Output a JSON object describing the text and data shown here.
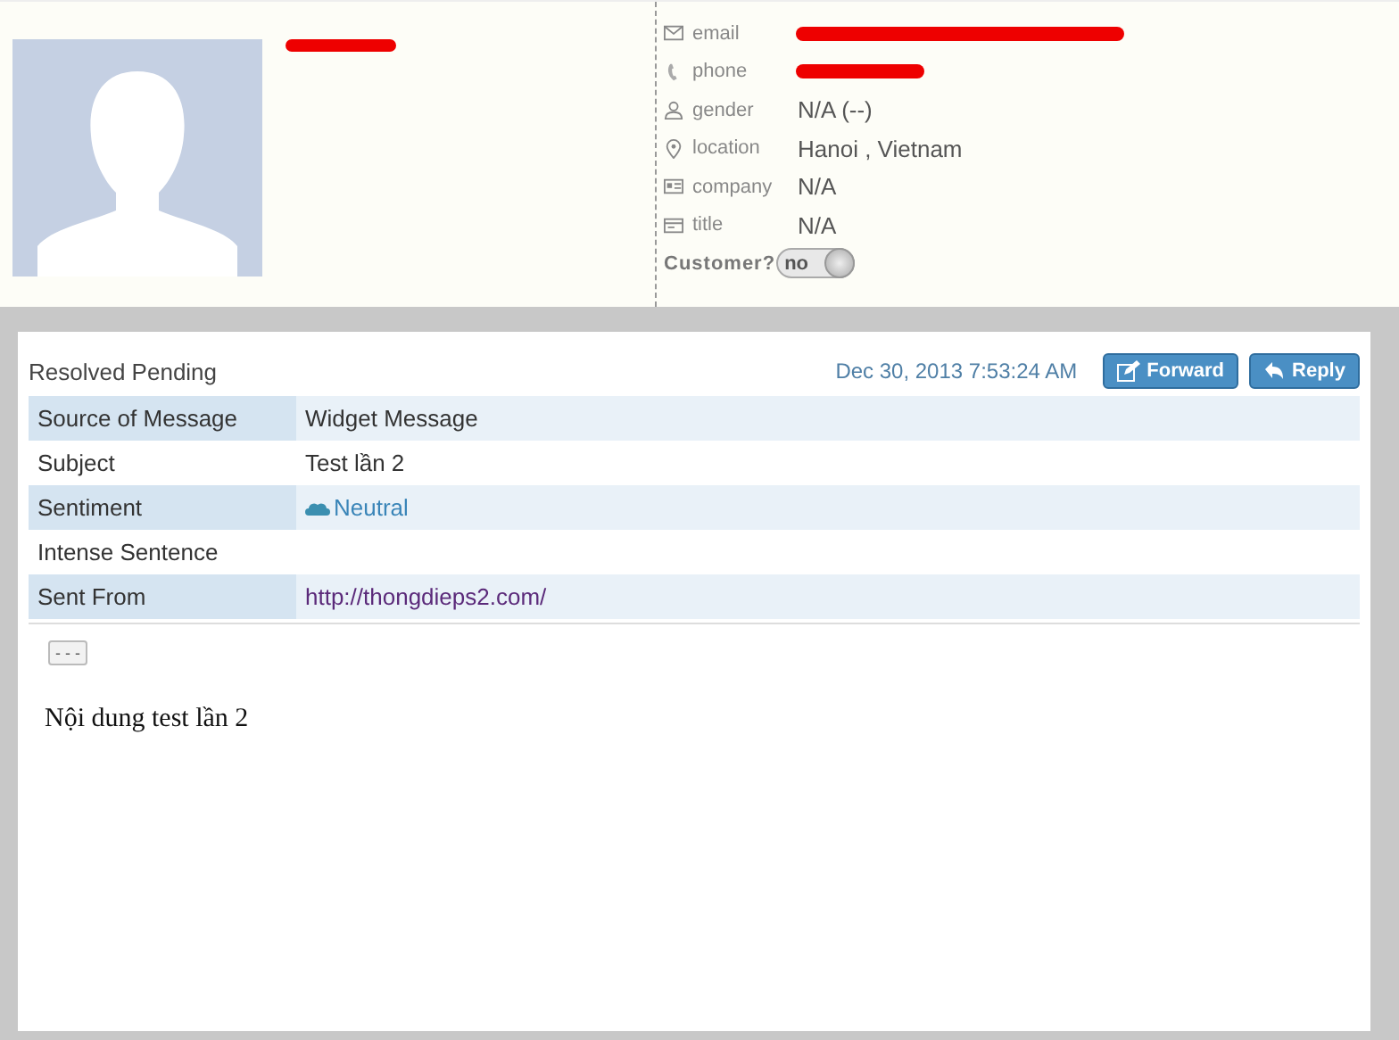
{
  "contact": {
    "fields": [
      {
        "kind": "mail",
        "label": "email",
        "redacted": true
      },
      {
        "kind": "phone",
        "label": "phone",
        "redacted": true
      },
      {
        "kind": "person",
        "label": "gender",
        "value": "N/A (--)"
      },
      {
        "kind": "pin",
        "label": "location",
        "value": "Hanoi , Vietnam"
      },
      {
        "kind": "card",
        "label": "company",
        "value": "N/A"
      },
      {
        "kind": "title",
        "label": "title",
        "value": "N/A"
      }
    ],
    "customer": {
      "label": "Customer?",
      "toggle_text": "no",
      "on": false
    }
  },
  "message": {
    "status": "Resolved Pending",
    "date": "Dec 30, 2013 7:53:24 AM",
    "buttons": [
      {
        "kind": "forward",
        "label": "Forward"
      },
      {
        "kind": "reply",
        "label": "Reply"
      }
    ],
    "rows": [
      {
        "label": "Source of Message",
        "kind": "text",
        "value": "Widget Message"
      },
      {
        "label": "Subject",
        "kind": "text",
        "value": "Test lần 2"
      },
      {
        "label": "Sentiment",
        "kind": "sentiment",
        "value": "Neutral"
      },
      {
        "label": "Intense Sentence",
        "kind": "text"
      },
      {
        "label": "Sent From",
        "kind": "link",
        "value": "http://thongdieps2.com/"
      }
    ],
    "expand_button": "- - -",
    "body": "Nội dung test lần 2"
  }
}
